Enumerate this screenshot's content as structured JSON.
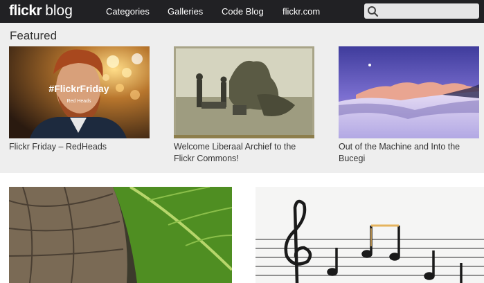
{
  "brand": {
    "main": "flickr",
    "sub": "blog"
  },
  "nav": [
    "Categories",
    "Galleries",
    "Code Blog",
    "flickr.com"
  ],
  "search": {
    "placeholder": "",
    "value": "",
    "icon": "search-icon"
  },
  "featured": {
    "title": "Featured",
    "posts": [
      {
        "title": "Flickr Friday – RedHeads",
        "overlay_title": "#FlickrFriday",
        "overlay_sub": "Red Heads"
      },
      {
        "title": "Welcome Liberaal Archief to the Flickr Commons!"
      },
      {
        "title": "Out of the Machine and Into the Bucegi"
      }
    ]
  }
}
